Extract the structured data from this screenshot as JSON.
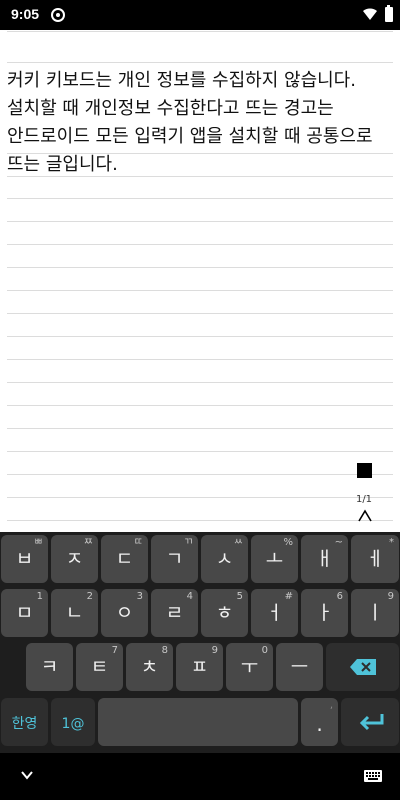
{
  "status_bar": {
    "time": "9:05",
    "icons": [
      "app-notification-icon",
      "wifi-icon",
      "battery-icon"
    ]
  },
  "editor": {
    "text": "커키 키보드는 개인 정보를 수집하지 않습니다.\n설치할 때 개인정보 수집한다고 뜨는 경고는\n안드로이드 모든 입력기 앱을 설치할 때 공통으로\n뜨는 글입니다.",
    "page_indicator": "1/1",
    "stop_icon": "stop-icon",
    "caret_icon": "caret-up-icon"
  },
  "keyboard": {
    "row1": [
      {
        "label": "ㅂ",
        "hint": "ㅃ"
      },
      {
        "label": "ㅈ",
        "hint": "ㅉ"
      },
      {
        "label": "ㄷ",
        "hint": "ㄸ"
      },
      {
        "label": "ㄱ",
        "hint": "ㄲ"
      },
      {
        "label": "ㅅ",
        "hint": "ㅆ"
      },
      {
        "label": "ㅗ",
        "hint": "%"
      },
      {
        "label": "ㅐ",
        "hint": "~"
      },
      {
        "label": "ㅔ",
        "hint": "*"
      }
    ],
    "row2": [
      {
        "label": "ㅁ",
        "hint": "1"
      },
      {
        "label": "ㄴ",
        "hint": "2"
      },
      {
        "label": "ㅇ",
        "hint": "3"
      },
      {
        "label": "ㄹ",
        "hint": "4"
      },
      {
        "label": "ㅎ",
        "hint": "5"
      },
      {
        "label": "ㅓ",
        "hint": "#"
      },
      {
        "label": "ㅏ",
        "hint": "6"
      },
      {
        "label": "ㅣ",
        "hint": "9"
      }
    ],
    "row3": [
      {
        "label": "ㅋ",
        "hint": ""
      },
      {
        "label": "ㅌ",
        "hint": "7"
      },
      {
        "label": "ㅊ",
        "hint": "8"
      },
      {
        "label": "ㅍ",
        "hint": "9"
      },
      {
        "label": "ㅜ",
        "hint": "0"
      },
      {
        "label": "ㅡ",
        "hint": ""
      }
    ],
    "lang_key": "한영",
    "symbol_key": "1@",
    "period_key": ".",
    "period_hint": ",",
    "accent_color": "#4fc3d9",
    "backspace_icon": "backspace-icon",
    "enter_icon": "enter-icon"
  },
  "nav_bar": {
    "left_icon": "hide-keyboard-icon",
    "right_icon": "keyboard-switch-icon"
  }
}
